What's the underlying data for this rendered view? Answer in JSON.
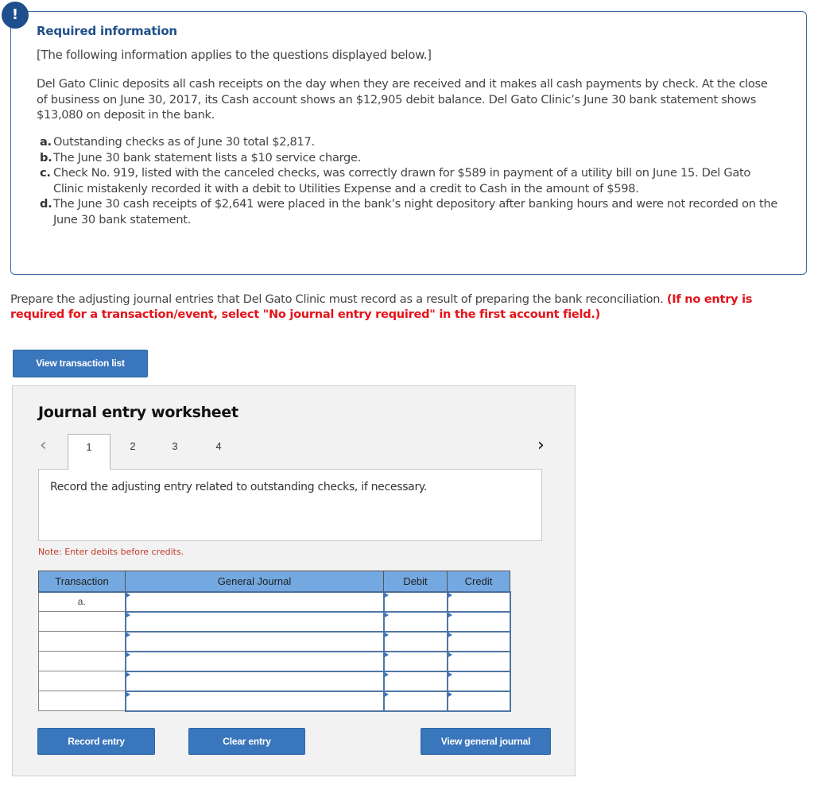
{
  "info": {
    "badge": "!",
    "title": "Required information",
    "subtitle": "[The following information applies to the questions displayed below.]",
    "paragraph": "Del Gato Clinic deposits all cash receipts on the day when they are received and it makes all cash payments by check. At the close of business on June 30, 2017, its Cash account shows an $12,905 debit balance. Del Gato Clinic’s June 30 bank statement shows $13,080 on deposit in the bank.",
    "items": [
      {
        "label": "a.",
        "text": "Outstanding checks as of June 30 total $2,817."
      },
      {
        "label": "b.",
        "text": "The June 30 bank statement lists a $10 service charge."
      },
      {
        "label": "c.",
        "text": "Check No. 919, listed with the canceled checks, was correctly drawn for $589 in payment of a utility bill on June 15. Del Gato Clinic mistakenly recorded it with a debit to Utilities Expense and a credit to Cash in the amount of $598."
      },
      {
        "label": "d.",
        "text": "The June 30 cash receipts of $2,641 were placed in the bank’s night depository after banking hours and were not recorded on the June 30 bank statement."
      }
    ]
  },
  "prompt": {
    "text": "Prepare the adjusting journal entries that Del Gato Clinic must record as a result of preparing the bank reconciliation. ",
    "warning": "(If no entry is required for a transaction/event, select \"No journal entry required\" in the first account field.)"
  },
  "buttons": {
    "view_transaction_list": "View transaction list",
    "record_entry": "Record entry",
    "clear_entry": "Clear entry",
    "view_general_journal": "View general journal"
  },
  "worksheet": {
    "title": "Journal entry worksheet",
    "prev_icon": "‹",
    "next_icon": "›",
    "tabs": [
      "1",
      "2",
      "3",
      "4"
    ],
    "active_tab": "1",
    "instruction": "Record the adjusting entry related to outstanding checks, if necessary.",
    "note": "Note: Enter debits before credits.",
    "table": {
      "headers": [
        "Transaction",
        "General Journal",
        "Debit",
        "Credit"
      ],
      "rows": [
        {
          "transaction": "a.",
          "account": "",
          "debit": "",
          "credit": ""
        },
        {
          "transaction": "",
          "account": "",
          "debit": "",
          "credit": ""
        },
        {
          "transaction": "",
          "account": "",
          "debit": "",
          "credit": ""
        },
        {
          "transaction": "",
          "account": "",
          "debit": "",
          "credit": ""
        },
        {
          "transaction": "",
          "account": "",
          "debit": "",
          "credit": ""
        },
        {
          "transaction": "",
          "account": "",
          "debit": "",
          "credit": ""
        }
      ]
    }
  }
}
